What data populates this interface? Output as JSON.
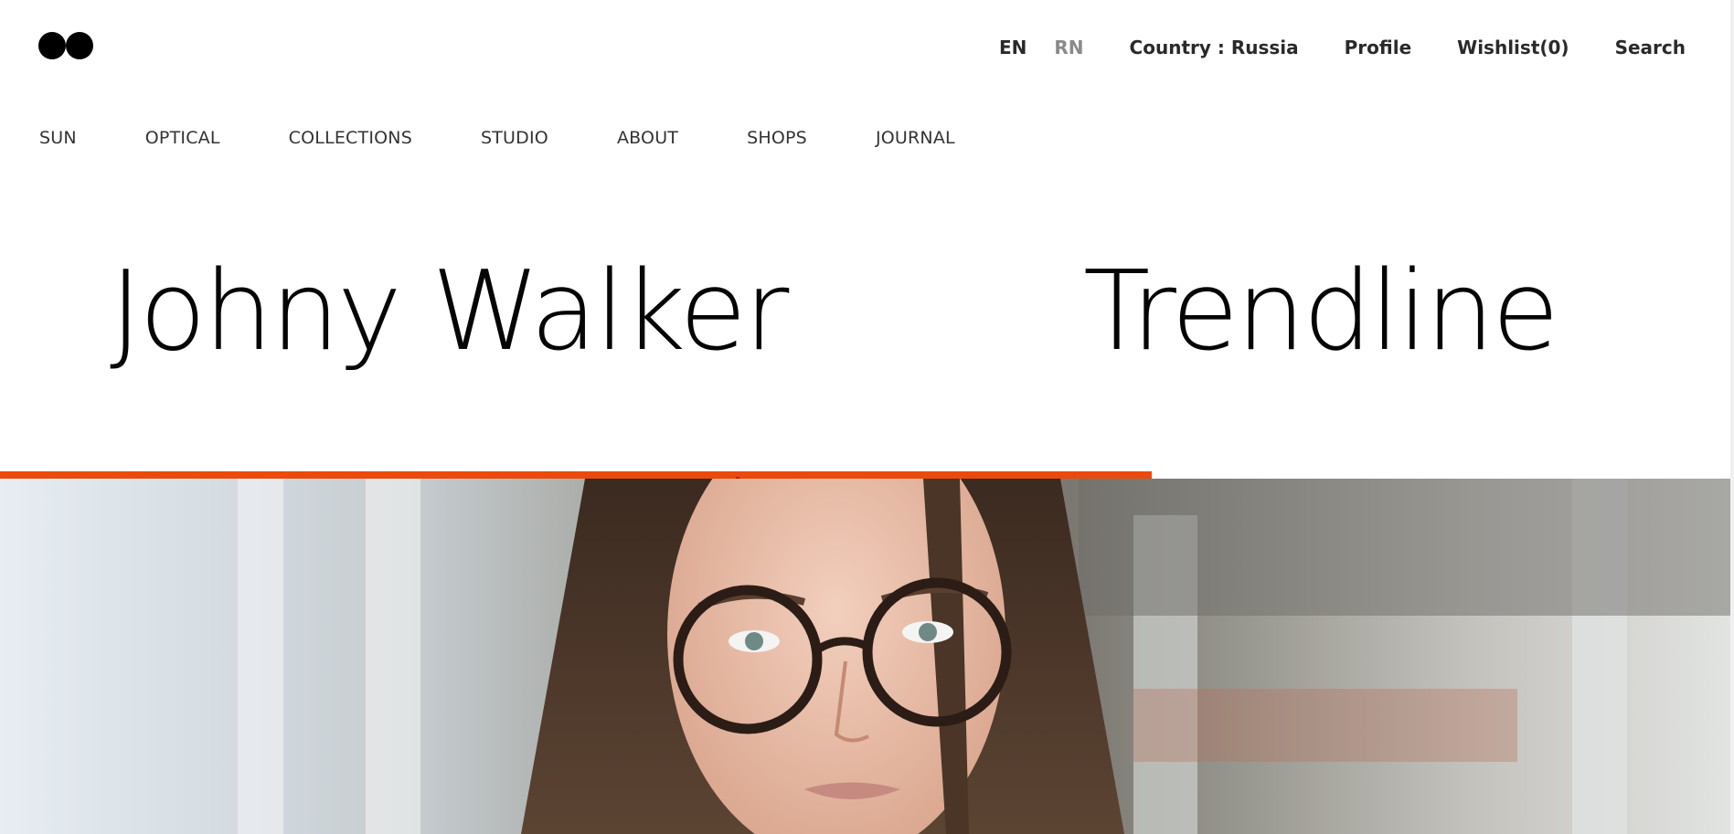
{
  "utility_nav": {
    "lang_en": "EN",
    "lang_rn": "RN",
    "country": "Country : Russia",
    "profile": "Profile",
    "wishlist": "Wishlist(0)",
    "search": "Search"
  },
  "main_nav": {
    "items": [
      "SUN",
      "OPTICAL",
      "COLLECTIONS",
      "STUDIO",
      "ABOUT",
      "SHOPS",
      "JOURNAL"
    ]
  },
  "hero": {
    "title_left": "Johny Walker",
    "title_right": "Trendline",
    "slide_progress": 0.664
  },
  "colors": {
    "accent": "#ea4a0c",
    "text": "#222222",
    "muted": "#8a8a8a"
  },
  "icons": {
    "logo": "two-black-dots-logo"
  }
}
